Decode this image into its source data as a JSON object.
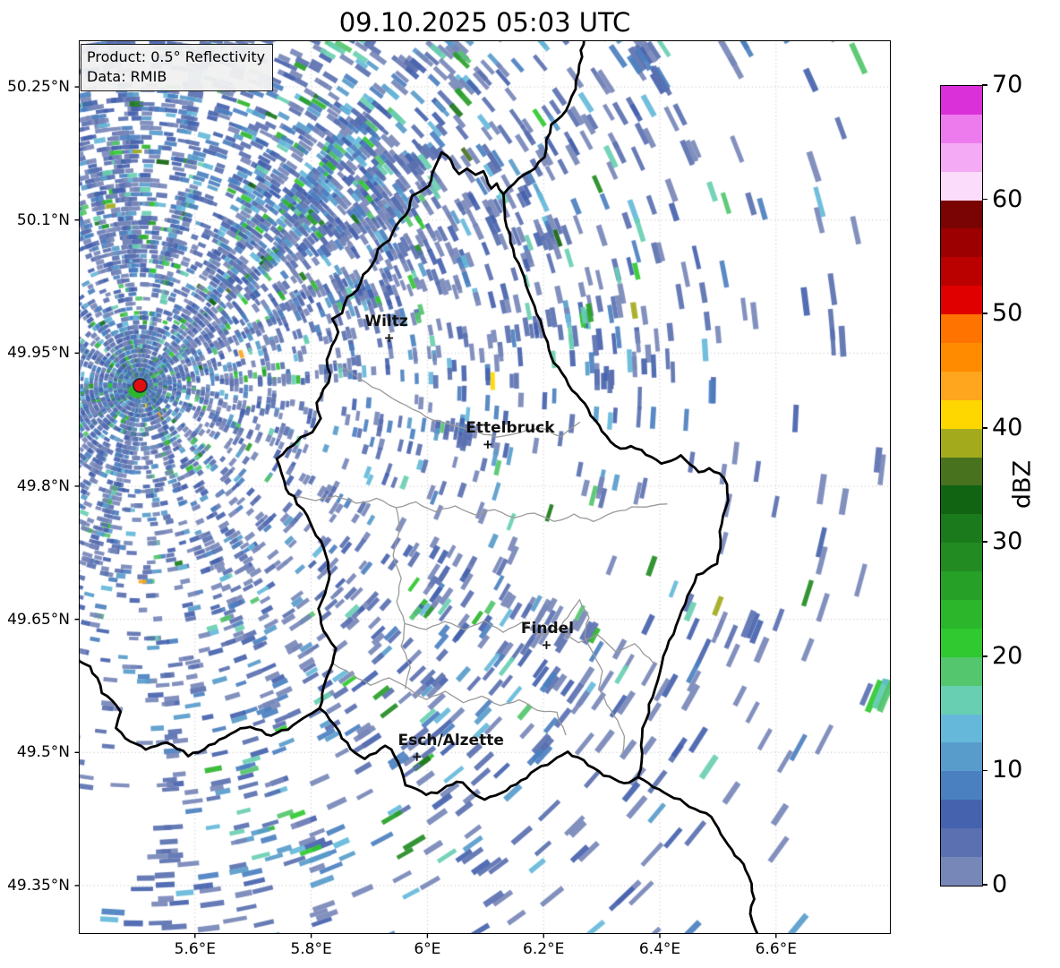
{
  "title": "09.10.2025 05:03 UTC",
  "info_box": {
    "product": "Product: 0.5° Reflectivity",
    "data_source": "Data: RMIB"
  },
  "axes": {
    "x_ticks": [
      {
        "label": "5.6°E",
        "lon": 5.6
      },
      {
        "label": "5.8°E",
        "lon": 5.8
      },
      {
        "label": "6°E",
        "lon": 6.0
      },
      {
        "label": "6.2°E",
        "lon": 6.2
      },
      {
        "label": "6.4°E",
        "lon": 6.4
      },
      {
        "label": "6.6°E",
        "lon": 6.6
      }
    ],
    "y_ticks": [
      {
        "label": "50.25°N",
        "lat": 50.25
      },
      {
        "label": "50.1°N",
        "lat": 50.1
      },
      {
        "label": "49.95°N",
        "lat": 49.95
      },
      {
        "label": "49.8°N",
        "lat": 49.8
      },
      {
        "label": "49.65°N",
        "lat": 49.65
      },
      {
        "label": "49.5°N",
        "lat": 49.5
      },
      {
        "label": "49.35°N",
        "lat": 49.35
      }
    ]
  },
  "colorbar": {
    "label": "dBZ",
    "min": 0,
    "max": 70,
    "segment_step": 2.5,
    "ticks": [
      0,
      10,
      20,
      30,
      40,
      50,
      60,
      70
    ],
    "colors_low_to_high": [
      "#7787b8",
      "#5a70b0",
      "#4562ae",
      "#4b80c0",
      "#589ccb",
      "#65b8da",
      "#69cfb2",
      "#54c66e",
      "#30c930",
      "#2cb62c",
      "#27a027",
      "#228b22",
      "#1b7a1b",
      "#116411",
      "#49721f",
      "#a3aa1c",
      "#ffd700",
      "#ffa51e",
      "#ff8c00",
      "#ff7300",
      "#e00000",
      "#bb0000",
      "#9c0000",
      "#7a0404",
      "#fbdcfb",
      "#f4aaf4",
      "#ee7bee",
      "#d930d9"
    ]
  },
  "map": {
    "cities": [
      {
        "name": "Wiltz",
        "lon": 5.934,
        "lat": 49.967,
        "label_dx": -3
      },
      {
        "name": "Ettelbruck",
        "lon": 6.104,
        "lat": 49.847,
        "label_dx": 25
      },
      {
        "name": "Findel",
        "lon": 6.205,
        "lat": 49.621,
        "label_dx": 1
      },
      {
        "name": "Esch/Alzette",
        "lon": 5.982,
        "lat": 49.495,
        "label_dx": 38
      }
    ],
    "radar_site": {
      "name": "radar",
      "lon": 5.5055,
      "lat": 49.9135,
      "dot_color": "#e01010"
    }
  },
  "chart_data": {
    "type": "heatmap",
    "title": "09.10.2025 05:03 UTC",
    "product": "0.5° Reflectivity",
    "source": "RMIB",
    "colorbar_label": "dBZ",
    "dbz_scale": {
      "min": 0,
      "max": 70,
      "step": 2.5,
      "tick_step": 10
    },
    "extent": {
      "lon_min": 5.4,
      "lon_max": 6.8,
      "lat_min": 49.295,
      "lat_max": 50.3
    },
    "radar_site": {
      "lon": 5.5055,
      "lat": 49.9135
    },
    "grid": "dotted",
    "legend_position": "right",
    "echo_character": "widespread weak speckled echoes 0-15 dBZ radiating from radar site, embedded green cells 20-35 dBZ NNE of radar and in SW band, rare 40-45 dBZ bins"
  }
}
